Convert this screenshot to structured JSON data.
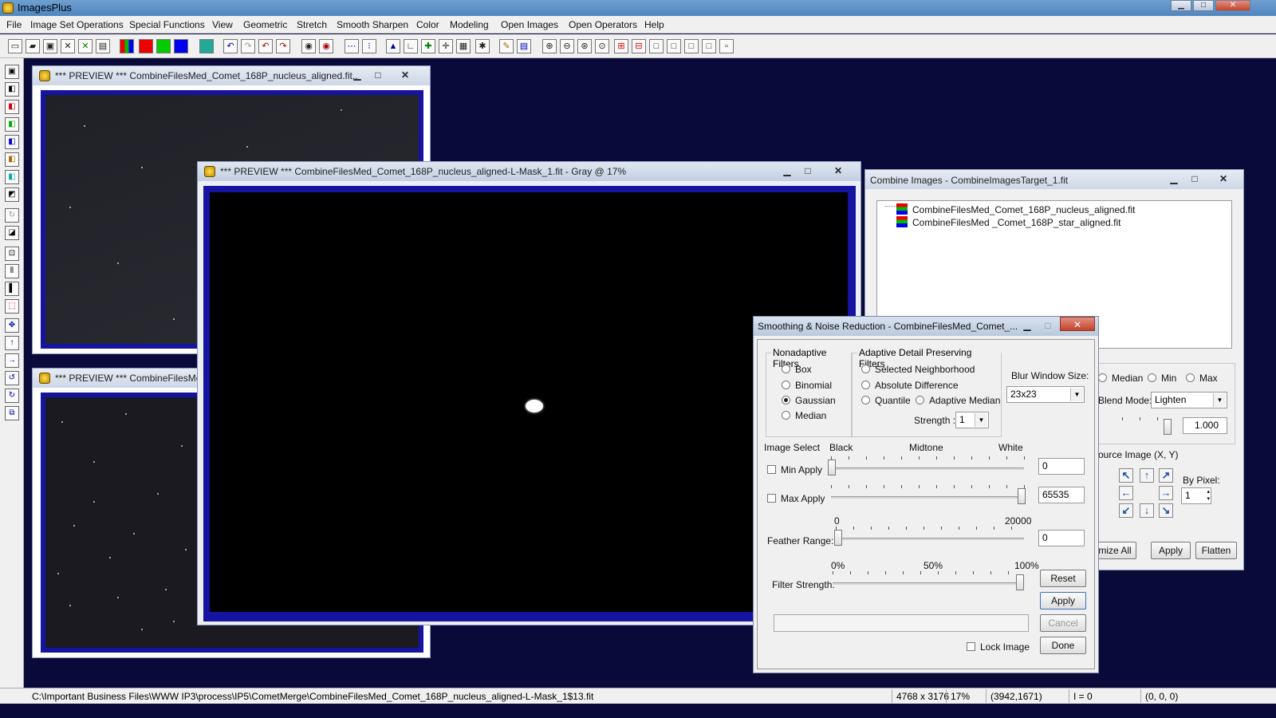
{
  "app": {
    "title": "ImagesPlus",
    "bg_color": "#0a0a3a"
  },
  "menu": [
    "File",
    "Image Set Operations",
    "Special Functions",
    "View",
    "Geometric",
    "Stretch",
    "Smooth Sharpen",
    "Color",
    "Modeling",
    "Open Images",
    "Open Operators",
    "Help"
  ],
  "preview1": {
    "title": "*** PREVIEW *** CombineFilesMed_Comet_168P_nucleus_aligned.fit..."
  },
  "preview2": {
    "title": "*** PREVIEW *** CombineFilesMe"
  },
  "preview3": {
    "title": "*** PREVIEW *** CombineFilesMed_Comet_168P_nucleus_aligned-L-Mask_1.fit - Gray @ 17%"
  },
  "combine": {
    "title": "Combine Images - CombineImagesTarget_1.fit",
    "files": [
      "CombineFilesMed_Comet_168P_nucleus_aligned.fit",
      "CombineFilesMed _Comet_168P_star_aligned.fit"
    ],
    "opt_median": "Median",
    "opt_min": "Min",
    "opt_max": "Max",
    "blend_label": "Blend Mode:",
    "blend_value": "Lighten",
    "opacity_value": "1.000",
    "source_label": "ource Image (X, Y)",
    "bypixel_label": "By Pixel:",
    "bypixel_value": "1",
    "minimize_all": "mize All",
    "apply": "Apply",
    "flatten": "Flatten"
  },
  "smooth": {
    "title": "Smoothing & Noise Reduction - CombineFilesMed_Comet_...",
    "nonadaptive_title": "Nonadaptive Filters",
    "nonadaptive": [
      "Box",
      "Binomial",
      "Gaussian",
      "Median"
    ],
    "selected_filter": "Gaussian",
    "adaptive_title": "Adaptive Detail Preserving Filters",
    "adaptive": {
      "selected_neighborhood": "Selected Neighborhood",
      "absolute_difference": "Absolute Difference",
      "quantile": "Quantile",
      "adaptive_median": "Adaptive Median"
    },
    "strength_label": "Strength :",
    "strength_value": "1",
    "blur_label": "Blur Window Size:",
    "blur_value": "23x23",
    "image_select": "Image Select",
    "black": "Black",
    "midtone": "Midtone",
    "white": "White",
    "min_apply": "Min Apply",
    "min_value": "0",
    "max_apply": "Max Apply",
    "max_value": "65535",
    "feather_min": "0",
    "feather_max": "20000",
    "feather_label": "Feather Range:",
    "feather_value": "0",
    "pct0": "0%",
    "pct50": "50%",
    "pct100": "100%",
    "filter_strength": "Filter Strength:",
    "reset": "Reset",
    "apply": "Apply",
    "cancel": "Cancel",
    "lock_image": "Lock Image",
    "done": "Done"
  },
  "status": {
    "path": "C:\\Important Business Files\\WWW IP3\\process\\IP5\\CometMerge\\CombineFilesMed_Comet_168P_nucleus_aligned-L-Mask_1$13.fit",
    "dims": "4768 x 3176",
    "zoom": "17%",
    "coords": "(3942,1671)",
    "intensity": "I = 0",
    "rgb": "(0, 0, 0)"
  }
}
